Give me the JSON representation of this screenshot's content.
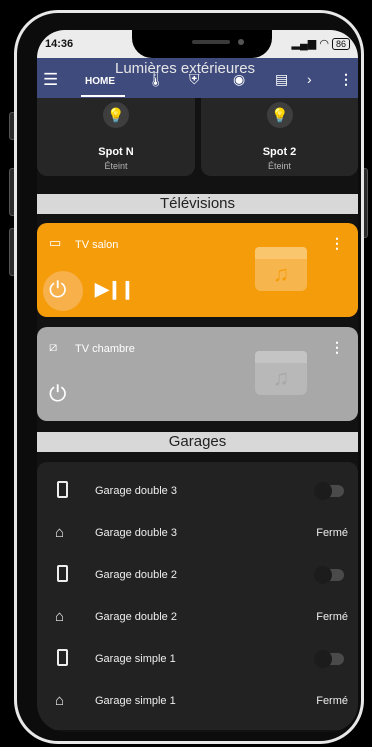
{
  "status_bar": {
    "time": "14:36",
    "battery": "86"
  },
  "header": {
    "title": "Lumières extérieures",
    "home_tab": "HOME"
  },
  "lights": [
    {
      "name": "Spot N",
      "state": "Éteint"
    },
    {
      "name": "Spot 2",
      "state": "Éteint"
    }
  ],
  "sections": {
    "televisions": "Télévisions",
    "garages": "Garages"
  },
  "tvs": [
    {
      "name": "TV salon",
      "color": "#f59c0b"
    },
    {
      "name": "TV chambre",
      "color": "#a8a8a8"
    }
  ],
  "garages": [
    {
      "name": "Garage double 3",
      "icon": "phone-icon",
      "value": ""
    },
    {
      "name": "Garage double 3",
      "icon": "garage-icon",
      "value": "Fermé"
    },
    {
      "name": "Garage double 2",
      "icon": "phone-icon",
      "value": ""
    },
    {
      "name": "Garage double 2",
      "icon": "garage-icon",
      "value": "Fermé"
    },
    {
      "name": "Garage simple 1",
      "icon": "phone-icon",
      "value": ""
    },
    {
      "name": "Garage simple 1",
      "icon": "garage-icon",
      "value": "Fermé"
    }
  ]
}
